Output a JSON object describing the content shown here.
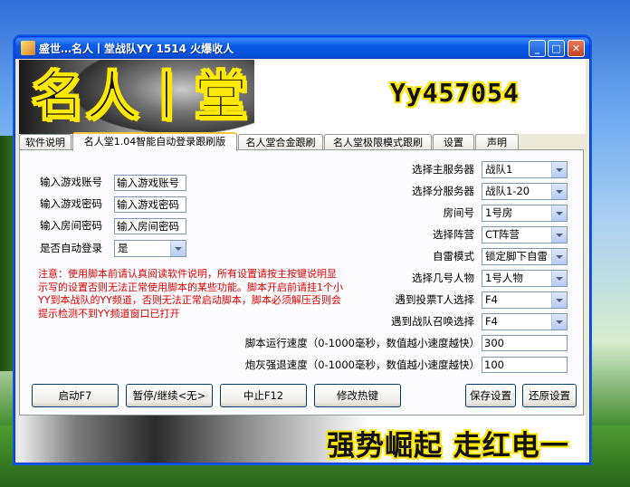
{
  "window": {
    "title": "盛世…名人丨堂战队YY  1514  火爆收人",
    "min_label": "_",
    "max_label": "□",
    "close_label": "✕"
  },
  "banner": {
    "title": "名人丨堂",
    "id": "Yy457054"
  },
  "tabs": [
    {
      "label": "软件说明"
    },
    {
      "label": "名人堂1.04智能自动登录跟刷版",
      "active": true
    },
    {
      "label": "名人堂合金跟刷"
    },
    {
      "label": "名人堂极限模式跟刷"
    },
    {
      "label": "设置"
    },
    {
      "label": "声明"
    }
  ],
  "form": {
    "account_label": "输入游戏账号",
    "account_value": "输入游戏账号",
    "password_label": "输入游戏密码",
    "password_value": "输入游戏密码",
    "room_pw_label": "输入房间密码",
    "room_pw_value": "输入房间密码",
    "auto_login_label": "是否自动登录",
    "auto_login_value": "是"
  },
  "notice": "注意：使用脚本前请认真阅读软件说明，所有设置请按主按键说明显示写的设置否则无法正常使用脚本的某些功能。脚本开启前请挂1个小YY到本战队的YY频道，否则无法正常启动脚本，脚本必须解压否则会提示检测不到YY频道窗口已打开",
  "settings": [
    {
      "label": "选择主服务器",
      "value": "战队1"
    },
    {
      "label": "选择分服务器",
      "value": "战队1-20"
    },
    {
      "label": "房间号",
      "value": "1号房"
    },
    {
      "label": "选择阵营",
      "value": "CT阵营"
    },
    {
      "label": "自雷模式",
      "value": "锁定脚下自雷"
    },
    {
      "label": "选择几号人物",
      "value": "1号人物"
    },
    {
      "label": "遇到投票T人选择",
      "value": "F4"
    },
    {
      "label": "遇到战队召唤选择",
      "value": "F4"
    }
  ],
  "speed": {
    "run_label": "脚本运行速度（0-1000毫秒，数值越小速度越快）",
    "run_value": "300",
    "ash_label": "炮灰强退速度（0-1000毫秒，数值越小速度越快）",
    "ash_value": "100"
  },
  "buttons": {
    "start": "启动F7",
    "pause": "暂停/继续<无>",
    "stop": "中止F12",
    "hotkey": "修改热键",
    "save": "保存设置",
    "restore": "还原设置"
  },
  "slogan": "强势崛起  走红电一"
}
